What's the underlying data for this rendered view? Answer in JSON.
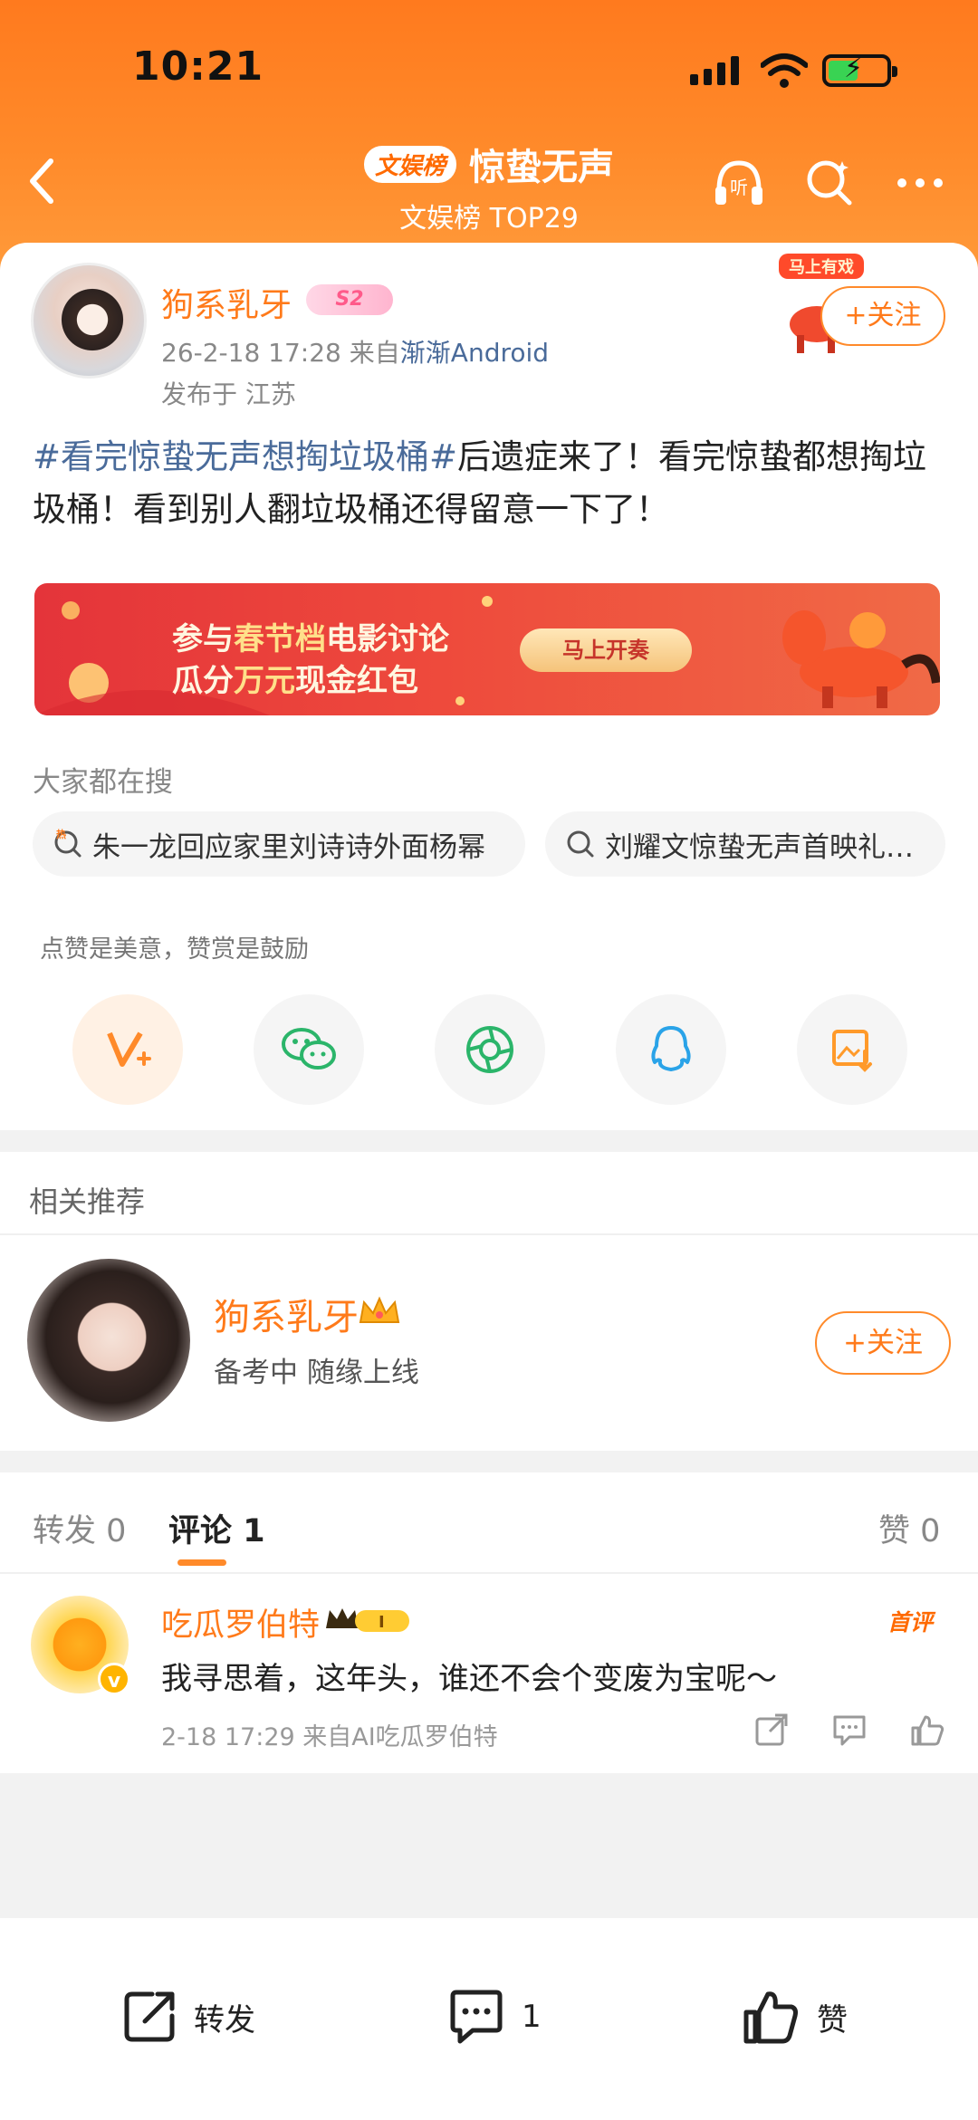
{
  "status_bar": {
    "time": "10:21"
  },
  "header": {
    "tag": "文娱榜",
    "title": "惊蛰无声",
    "subtitle": "文娱榜 TOP29"
  },
  "post": {
    "author": "狗系乳牙",
    "level": "S2",
    "timestamp": "26-2-18 17:28",
    "source_prefix": "来自",
    "source": "渐渐Android",
    "location": "发布于 江苏",
    "follow_label": "+关注",
    "hashtag": "#看完惊蛰无声想掏垃圾桶#",
    "text": "后遗症来了！看完惊蛰都想掏垃圾桶！看到别人翻垃圾桶还得留意一下了！"
  },
  "banner": {
    "line1_a": "参与",
    "line1_b": "春节档",
    "line1_c": "电影讨论",
    "line2_a": "瓜分",
    "line2_b": "万元",
    "line2_c": "现金红包",
    "cta": "马上开奏"
  },
  "hot_search": {
    "label": "大家都在搜",
    "items": [
      "朱一龙回应家里刘诗诗外面杨幂",
      "刘耀文惊蛰无声首映礼…"
    ]
  },
  "tip": {
    "label": "点赞是美意，赞赏是鼓励",
    "share_icons": [
      "reward-icon",
      "wechat-icon",
      "moments-icon",
      "qq-icon",
      "save-image-icon"
    ]
  },
  "related": {
    "title": "相关推荐",
    "name": "狗系乳牙",
    "desc": "备考中 随缘上线",
    "follow_label": "+关注"
  },
  "comments": {
    "tabs": [
      {
        "label": "转发",
        "count": "0"
      },
      {
        "label": "评论",
        "count": "1"
      }
    ],
    "likes_label": "赞",
    "likes_count": "0",
    "item": {
      "user": "吃瓜罗伯特",
      "badge": "首评",
      "text": "我寻思着，这年头，谁还不会个变废为宝呢～",
      "meta": "2-18 17:29  来自AI吃瓜罗伯特"
    }
  },
  "bottom_bar": {
    "repost": "转发",
    "comment_count": "1",
    "like": "赞"
  },
  "colors": {
    "accent": "#ff7a1a",
    "link": "#4a6b9a",
    "header": "#ff8a2a"
  }
}
